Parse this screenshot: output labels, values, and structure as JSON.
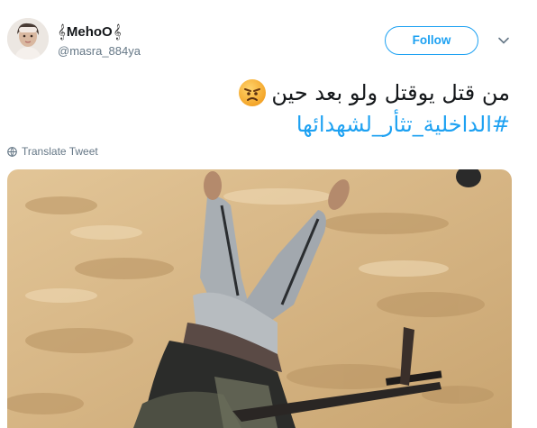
{
  "user": {
    "display_name": "MehoO",
    "clef_left": "𝄞",
    "clef_right": "𝄞",
    "handle": "@masra_884ya"
  },
  "actions": {
    "follow_label": "Follow",
    "menu_icon": "chevron-down-icon"
  },
  "tweet": {
    "text_line1": "من قتل يوقتل ولو بعد حين",
    "emoji": "angry-face-emoji",
    "hashtag": "#الداخلية_تثأر_لشهدائها",
    "translate_label": "Translate Tweet"
  },
  "colors": {
    "accent": "#1da1f2",
    "secondary_text": "#657786",
    "sand": "#d8b98a"
  }
}
